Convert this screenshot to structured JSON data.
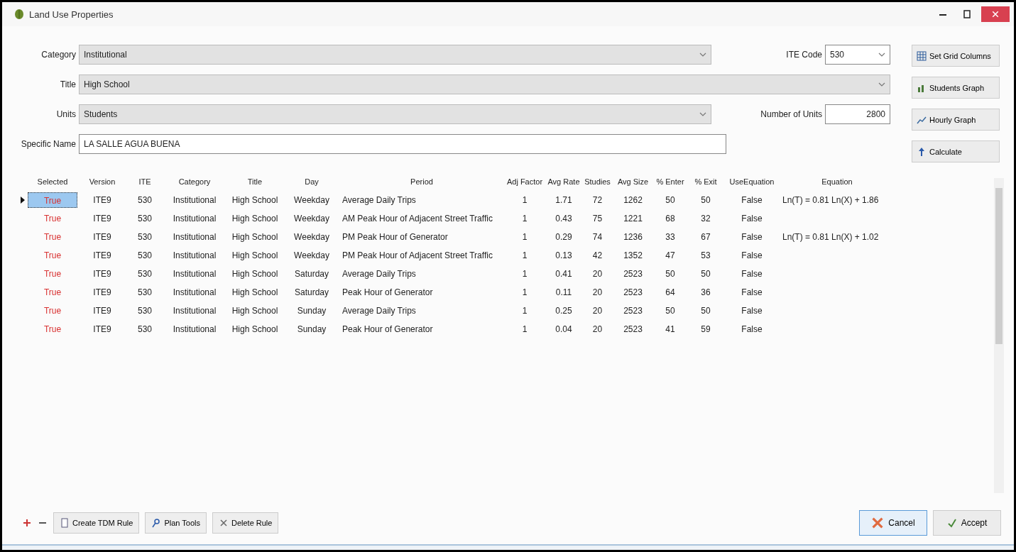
{
  "window": {
    "title": "Land Use Properties"
  },
  "form": {
    "category": {
      "label": "Category",
      "value": "Institutional"
    },
    "ite_code": {
      "label": "ITE Code",
      "value": "530"
    },
    "title": {
      "label": "Title",
      "value": "High School"
    },
    "units": {
      "label": "Units",
      "value": "Students"
    },
    "number_of_units": {
      "label": "Number of Units",
      "value": "2800"
    },
    "specific_name": {
      "label": "Specific Name",
      "value": "LA SALLE AGUA BUENA"
    }
  },
  "side_buttons": [
    {
      "label": "Set Grid Columns"
    },
    {
      "label": "Students Graph"
    },
    {
      "label": "Hourly Graph"
    },
    {
      "label": "Calculate"
    }
  ],
  "table": {
    "columns": [
      "Selected",
      "Version",
      "ITE",
      "Category",
      "Title",
      "Day",
      "Period",
      "Adj Factor",
      "Avg Rate",
      "Studies",
      "Avg Size",
      "% Enter",
      "% Exit",
      "UseEquation",
      "Equation"
    ],
    "rows": [
      {
        "selected": true,
        "cells": [
          "True",
          "ITE9",
          "530",
          "Institutional",
          "High School",
          "Weekday",
          "Average Daily Trips",
          "1",
          "1.71",
          "72",
          "1262",
          "50",
          "50",
          "False",
          "Ln(T) = 0.81 Ln(X) + 1.86"
        ]
      },
      {
        "selected": false,
        "cells": [
          "True",
          "ITE9",
          "530",
          "Institutional",
          "High School",
          "Weekday",
          "AM Peak Hour of Adjacent Street Traffic",
          "1",
          "0.43",
          "75",
          "1221",
          "68",
          "32",
          "False",
          ""
        ]
      },
      {
        "selected": false,
        "cells": [
          "True",
          "ITE9",
          "530",
          "Institutional",
          "High School",
          "Weekday",
          "PM Peak Hour of Generator",
          "1",
          "0.29",
          "74",
          "1236",
          "33",
          "67",
          "False",
          "Ln(T) = 0.81 Ln(X) + 1.02"
        ]
      },
      {
        "selected": false,
        "cells": [
          "True",
          "ITE9",
          "530",
          "Institutional",
          "High School",
          "Weekday",
          "PM Peak Hour of Adjacent Street Traffic",
          "1",
          "0.13",
          "42",
          "1352",
          "47",
          "53",
          "False",
          ""
        ]
      },
      {
        "selected": false,
        "cells": [
          "True",
          "ITE9",
          "530",
          "Institutional",
          "High School",
          "Saturday",
          "Average Daily Trips",
          "1",
          "0.41",
          "20",
          "2523",
          "50",
          "50",
          "False",
          ""
        ]
      },
      {
        "selected": false,
        "cells": [
          "True",
          "ITE9",
          "530",
          "Institutional",
          "High School",
          "Saturday",
          "Peak Hour of Generator",
          "1",
          "0.11",
          "20",
          "2523",
          "64",
          "36",
          "False",
          ""
        ]
      },
      {
        "selected": false,
        "cells": [
          "True",
          "ITE9",
          "530",
          "Institutional",
          "High School",
          "Sunday",
          "Average Daily Trips",
          "1",
          "0.25",
          "20",
          "2523",
          "50",
          "50",
          "False",
          ""
        ]
      },
      {
        "selected": false,
        "cells": [
          "True",
          "ITE9",
          "530",
          "Institutional",
          "High School",
          "Sunday",
          "Peak Hour of Generator",
          "1",
          "0.04",
          "20",
          "2523",
          "41",
          "59",
          "False",
          ""
        ]
      }
    ]
  },
  "toolbar": [
    {
      "label": "Create TDM Rule"
    },
    {
      "label": "Plan Tools"
    },
    {
      "label": "Delete Rule"
    }
  ],
  "buttons": [
    {
      "label": "Cancel",
      "kind": "cancel"
    },
    {
      "label": "Accept",
      "kind": "accept"
    }
  ]
}
